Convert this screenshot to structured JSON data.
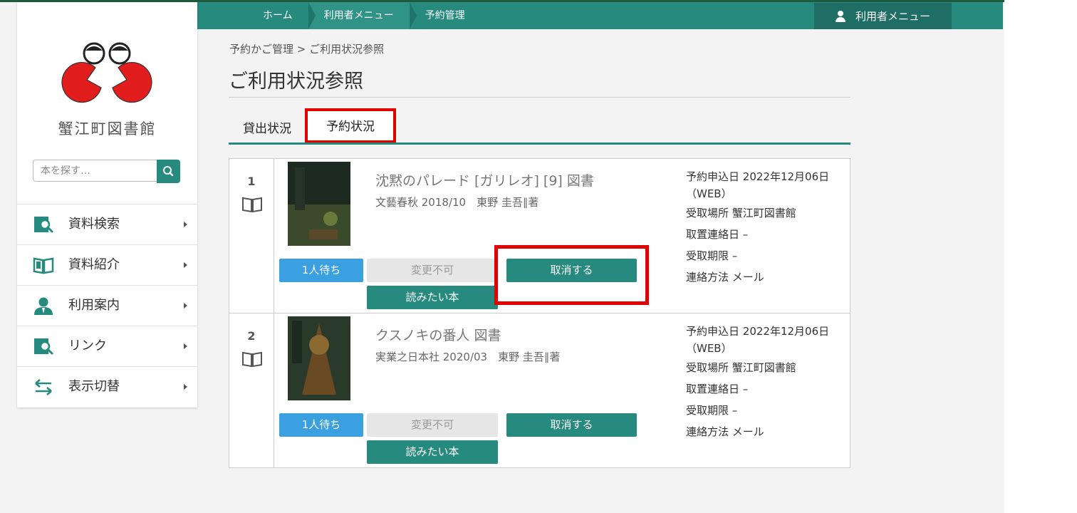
{
  "topnav": {
    "breadcrumb": [
      "ホーム",
      "利用者メニュー",
      "予約管理"
    ],
    "user_menu": "利用者メニュー"
  },
  "sidebar": {
    "library_name": "蟹江町図書館",
    "search_placeholder": "本を探す…",
    "menu": [
      {
        "label": "資料検索",
        "icon": "search-book-icon"
      },
      {
        "label": "資料紹介",
        "icon": "open-book-icon"
      },
      {
        "label": "利用案内",
        "icon": "person-icon"
      },
      {
        "label": "リンク",
        "icon": "search-book-icon"
      },
      {
        "label": "表示切替",
        "icon": "swap-arrows-icon"
      }
    ]
  },
  "main": {
    "breadcrumb": "予約かご管理 > ご利用状況参照",
    "title": "ご利用状況参照",
    "tabs": [
      "貸出状況",
      "予約状況"
    ],
    "active_tab": "予約状況"
  },
  "reservations": [
    {
      "no": "1",
      "title": "沈黙のパレード [ガリレオ] [9] 図書",
      "meta": "文藝春秋 2018/10　東野 圭吾∥著",
      "status": "1人待ち",
      "change": "変更不可",
      "cancel": "取消する",
      "want": "読みたい本",
      "applied_label": "予約申込日",
      "applied_value": "2022年12月06日",
      "applied_via": "（WEB）",
      "pickup_label": "受取場所",
      "pickup_value": "蟹江町図書館",
      "hold_label": "取置連絡日",
      "hold_value": "–",
      "deadline_label": "受取期限",
      "deadline_value": "–",
      "contact_label": "連絡方法",
      "contact_value": "メール"
    },
    {
      "no": "2",
      "title": "クスノキの番人 図書",
      "meta": "実業之日本社 2020/03　東野 圭吾∥著",
      "status": "1人待ち",
      "change": "変更不可",
      "cancel": "取消する",
      "want": "読みたい本",
      "applied_label": "予約申込日",
      "applied_value": "2022年12月06日",
      "applied_via": "（WEB）",
      "pickup_label": "受取場所",
      "pickup_value": "蟹江町図書館",
      "hold_label": "取置連絡日",
      "hold_value": "–",
      "deadline_label": "受取期限",
      "deadline_value": "–",
      "contact_label": "連絡方法",
      "contact_value": "メール"
    }
  ],
  "colors": {
    "accent": "#268a7e",
    "highlight": "#e00000",
    "status_blue": "#3aa0e0"
  }
}
